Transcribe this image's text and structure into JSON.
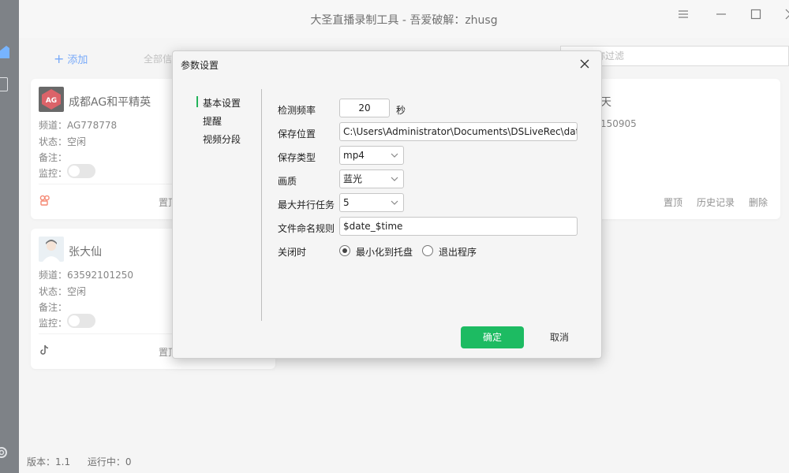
{
  "window": {
    "title": "大圣直播录制工具 - 吾爱破解：zhusg"
  },
  "toolbar": {
    "add_label": "添加",
    "filter_tab": "全部信",
    "search_placeholder": "称过滤"
  },
  "cards": [
    {
      "name": "成都AG和平精英",
      "channel": "频道：AG778778",
      "status": "状态：空闲",
      "note": "备注：",
      "monitor": "监控：",
      "platform_icon": "kuaishou-icon",
      "action_partial": "置顶"
    },
    {
      "name": "张大仙",
      "channel": "频道：63592101250",
      "status": "状态：空闲",
      "note": "备注：",
      "monitor": "监控：",
      "platform_icon": "douyin-icon",
      "action_partial": "置顶"
    },
    {
      "name_partial": "天",
      "channel_partial": "150905",
      "actions": [
        "置顶",
        "历史记录",
        "删除"
      ]
    }
  ],
  "dialog": {
    "title": "参数设置",
    "nav": [
      "基本设置",
      "提醒",
      "视频分段"
    ],
    "active_nav": 0,
    "fields": {
      "interval_label": "检测频率",
      "interval_value": "20",
      "interval_unit": "秒",
      "path_label": "保存位置",
      "path_value": "C:\\Users\\Administrator\\Documents\\DSLiveRec\\data",
      "type_label": "保存类型",
      "type_value": "mp4",
      "quality_label": "画质",
      "quality_value": "蓝光",
      "parallel_label": "最大并行任务",
      "parallel_value": "5",
      "naming_label": "文件命名规则",
      "naming_value": "$date_$time",
      "close_label": "关闭时",
      "close_option_a": "最小化到托盘",
      "close_option_b": "退出程序"
    },
    "ok_label": "确定",
    "cancel_label": "取消"
  },
  "status": {
    "version": "版本：1.1",
    "running": "运行中：0"
  },
  "colors": {
    "accent_green": "#1dbb62",
    "link_blue": "#2f7cf6"
  }
}
